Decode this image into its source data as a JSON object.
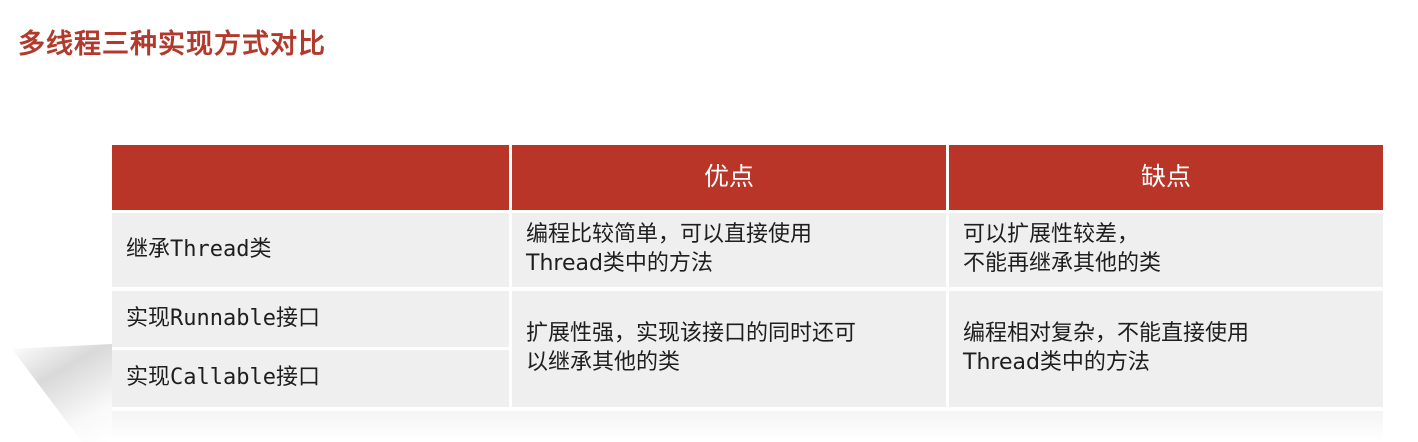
{
  "title": "多线程三种实现方式对比",
  "table": {
    "headers": [
      "",
      "优点",
      "缺点"
    ],
    "rows": [
      {
        "labels": [
          "继承Thread类"
        ],
        "pros": [
          "编程比较简单，可以直接使用",
          "Thread类中的方法"
        ],
        "cons": [
          "可以扩展性较差，",
          "不能再继承其他的类"
        ]
      },
      {
        "labels": [
          "实现Runnable接口",
          "实现Callable接口"
        ],
        "pros": [
          "扩展性强，实现该接口的同时还可",
          "以继承其他的类"
        ],
        "cons": [
          "编程相对复杂，不能直接使用",
          "Thread类中的方法"
        ]
      }
    ]
  },
  "colors": {
    "accent": "#b83528",
    "title": "#b23a2c",
    "cell_bg": "#efefef",
    "text": "#1e1e1e"
  }
}
